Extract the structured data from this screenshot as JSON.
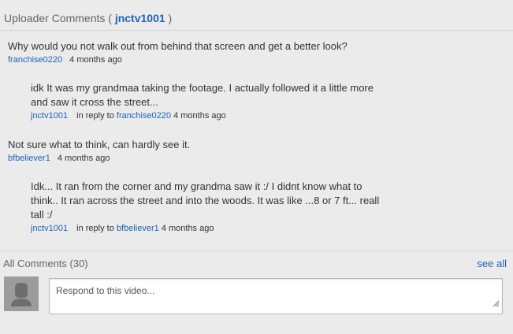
{
  "uploader_comments": {
    "label": "Uploader Comments (",
    "user": "jnctv1001",
    "close": ")"
  },
  "comments": [
    {
      "text": "Why would you not walk out from behind that screen and get a better look?",
      "author": "franchise0220",
      "age": "4 months ago"
    },
    {
      "text_line1": "idk It was my grandmaa taking the footage. I actually followed it a little more",
      "text_line2": "and saw it cross the street...",
      "author": "jnctv1001",
      "reply_prefix": "in reply to",
      "reply_to": "franchise0220",
      "age": "4 months ago"
    },
    {
      "text": "Not sure what to think, can hardly see it.",
      "author": "bfbeliever1",
      "age": "4 months ago"
    },
    {
      "text_line1": "Idk... It ran from the corner and my grandma saw it :/ I didnt know what to",
      "text_line2": "think.. It ran across the street and into the woods. It was like ...8 or 7 ft... reall",
      "text_line3": "tall :/",
      "author": "jnctv1001",
      "reply_prefix": "in reply to",
      "reply_to": "bfbeliever1",
      "age": "4 months ago"
    }
  ],
  "all_comments": {
    "label": "All Comments (30)",
    "see_all": "see all"
  },
  "reply_input": {
    "placeholder": "Respond to this video..."
  },
  "icons": {
    "avatar": "default-user-avatar-icon",
    "resize": "textarea-resize-grip-icon"
  }
}
